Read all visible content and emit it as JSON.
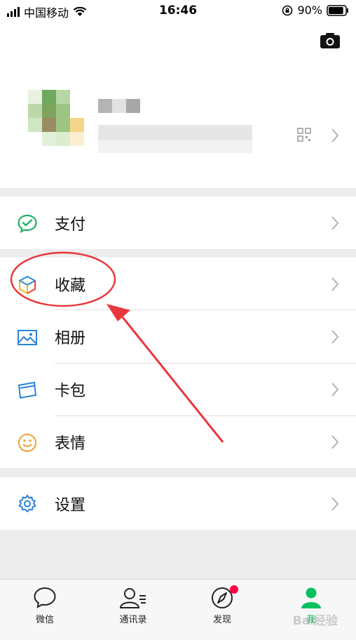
{
  "status_bar": {
    "carrier": "中国移动",
    "time": "16:46",
    "battery": "90%",
    "battery_level": 0.9
  },
  "profile": {
    "camera_icon": "camera-icon",
    "qr_icon": "qr-code-icon"
  },
  "menu": {
    "pay": {
      "label": "支付",
      "icon": "wechat-pay-icon",
      "color": "#21b066"
    },
    "favorites": {
      "label": "收藏",
      "icon": "cube-icon"
    },
    "album": {
      "label": "相册",
      "icon": "image-icon",
      "color": "#2d82d6"
    },
    "cards": {
      "label": "卡包",
      "icon": "card-icon",
      "color": "#2d82d6"
    },
    "stickers": {
      "label": "表情",
      "icon": "smiley-icon",
      "color": "#f0a030"
    },
    "settings": {
      "label": "设置",
      "icon": "gear-icon",
      "color": "#2d82d6"
    }
  },
  "tabbar": {
    "tabs": [
      {
        "label": "微信",
        "icon": "chat-bubble-icon"
      },
      {
        "label": "通讯录",
        "icon": "contacts-icon"
      },
      {
        "label": "发现",
        "icon": "compass-icon"
      },
      {
        "label": "我",
        "icon": "person-icon",
        "active": true
      }
    ],
    "active_color": "#07c160"
  },
  "watermark": "Bai经验"
}
